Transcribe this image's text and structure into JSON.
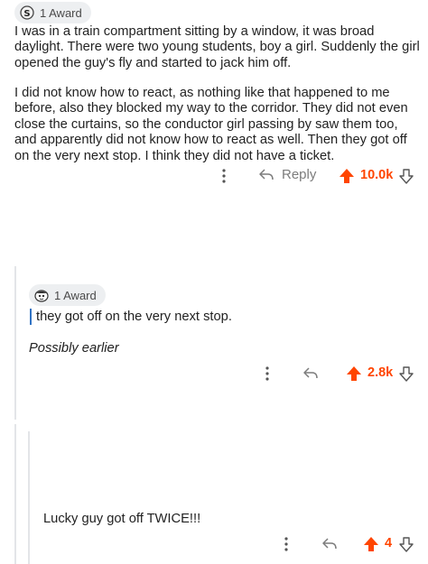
{
  "top_comment": {
    "award_label": "1 Award",
    "paragraph1": "I was in a train compartment sitting by a window, it was broad daylight. There were two young students, boy a girl. Suddenly the girl opened the guy's fly and started to jack him off.",
    "paragraph2": "I did not know how to react, as nothing like that happened to me before, also they blocked my way to the corridor. They did not even close the curtains, so the conductor girl passing by saw them too, and apparently did not know how to react as well. Then they got off on the very next stop. I think they did not have a ticket.",
    "reply_label": "Reply",
    "score": "10.0k",
    "icons": [
      "award-silver-icon",
      "more-vertical-icon",
      "reply-arrow-icon",
      "upvote-arrow-icon",
      "downvote-arrow-icon"
    ]
  },
  "reply_comment": {
    "award_label": "1 Award",
    "quote": "they got off on the very next stop.",
    "text": "Possibly earlier",
    "score": "2.8k"
  },
  "nested_reply": {
    "text": "Lucky guy got off TWICE!!!",
    "score": "4"
  },
  "colors": {
    "upvote": "#ff4500",
    "muted": "#7c7c7c",
    "quote_bar": "#3173c4",
    "thread_line": "#e3e5e8"
  }
}
